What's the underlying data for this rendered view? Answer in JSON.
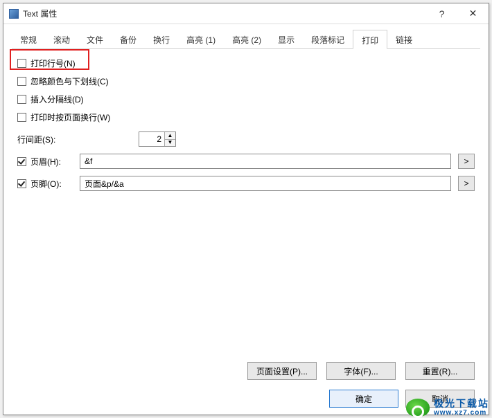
{
  "window": {
    "title": "Text 属性"
  },
  "titlebar": {
    "help": "?",
    "close": "✕"
  },
  "tabs": {
    "items": [
      "常规",
      "滚动",
      "文件",
      "备份",
      "换行",
      "高亮 (1)",
      "高亮 (2)",
      "显示",
      "段落标记",
      "打印",
      "链接"
    ],
    "activeIndex": 9
  },
  "print": {
    "checks": {
      "printLineNumbers": "打印行号(N)",
      "ignoreColorsUnderlines": "忽略颜色与下划线(C)",
      "insertSeparator": "插入分隔线(D)",
      "wrapOnPrint": "打印时按页面换行(W)"
    },
    "lineSpacing": {
      "label": "行间距(S):",
      "value": "2"
    },
    "header": {
      "label": "页眉(H):",
      "value": "&f",
      "moreBtn": ">"
    },
    "footer": {
      "label": "页脚(O):",
      "value": "页面&p/&a",
      "moreBtn": ">"
    }
  },
  "buttons": {
    "pageSetup": "页面设置(P)...",
    "font": "字体(F)...",
    "reset": "重置(R)...",
    "ok": "确定",
    "cancel": "取消"
  },
  "watermark": {
    "main": "极光下载站",
    "sub": "www.xz7.com"
  }
}
